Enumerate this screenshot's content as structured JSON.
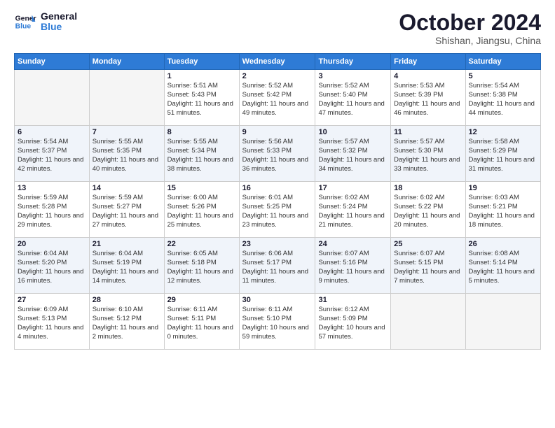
{
  "header": {
    "logo_general": "General",
    "logo_blue": "Blue",
    "month": "October 2024",
    "location": "Shishan, Jiangsu, China"
  },
  "weekdays": [
    "Sunday",
    "Monday",
    "Tuesday",
    "Wednesday",
    "Thursday",
    "Friday",
    "Saturday"
  ],
  "weeks": [
    [
      {
        "day": "",
        "info": ""
      },
      {
        "day": "",
        "info": ""
      },
      {
        "day": "1",
        "info": "Sunrise: 5:51 AM\nSunset: 5:43 PM\nDaylight: 11 hours and 51 minutes."
      },
      {
        "day": "2",
        "info": "Sunrise: 5:52 AM\nSunset: 5:42 PM\nDaylight: 11 hours and 49 minutes."
      },
      {
        "day": "3",
        "info": "Sunrise: 5:52 AM\nSunset: 5:40 PM\nDaylight: 11 hours and 47 minutes."
      },
      {
        "day": "4",
        "info": "Sunrise: 5:53 AM\nSunset: 5:39 PM\nDaylight: 11 hours and 46 minutes."
      },
      {
        "day": "5",
        "info": "Sunrise: 5:54 AM\nSunset: 5:38 PM\nDaylight: 11 hours and 44 minutes."
      }
    ],
    [
      {
        "day": "6",
        "info": "Sunrise: 5:54 AM\nSunset: 5:37 PM\nDaylight: 11 hours and 42 minutes."
      },
      {
        "day": "7",
        "info": "Sunrise: 5:55 AM\nSunset: 5:35 PM\nDaylight: 11 hours and 40 minutes."
      },
      {
        "day": "8",
        "info": "Sunrise: 5:55 AM\nSunset: 5:34 PM\nDaylight: 11 hours and 38 minutes."
      },
      {
        "day": "9",
        "info": "Sunrise: 5:56 AM\nSunset: 5:33 PM\nDaylight: 11 hours and 36 minutes."
      },
      {
        "day": "10",
        "info": "Sunrise: 5:57 AM\nSunset: 5:32 PM\nDaylight: 11 hours and 34 minutes."
      },
      {
        "day": "11",
        "info": "Sunrise: 5:57 AM\nSunset: 5:30 PM\nDaylight: 11 hours and 33 minutes."
      },
      {
        "day": "12",
        "info": "Sunrise: 5:58 AM\nSunset: 5:29 PM\nDaylight: 11 hours and 31 minutes."
      }
    ],
    [
      {
        "day": "13",
        "info": "Sunrise: 5:59 AM\nSunset: 5:28 PM\nDaylight: 11 hours and 29 minutes."
      },
      {
        "day": "14",
        "info": "Sunrise: 5:59 AM\nSunset: 5:27 PM\nDaylight: 11 hours and 27 minutes."
      },
      {
        "day": "15",
        "info": "Sunrise: 6:00 AM\nSunset: 5:26 PM\nDaylight: 11 hours and 25 minutes."
      },
      {
        "day": "16",
        "info": "Sunrise: 6:01 AM\nSunset: 5:25 PM\nDaylight: 11 hours and 23 minutes."
      },
      {
        "day": "17",
        "info": "Sunrise: 6:02 AM\nSunset: 5:24 PM\nDaylight: 11 hours and 21 minutes."
      },
      {
        "day": "18",
        "info": "Sunrise: 6:02 AM\nSunset: 5:22 PM\nDaylight: 11 hours and 20 minutes."
      },
      {
        "day": "19",
        "info": "Sunrise: 6:03 AM\nSunset: 5:21 PM\nDaylight: 11 hours and 18 minutes."
      }
    ],
    [
      {
        "day": "20",
        "info": "Sunrise: 6:04 AM\nSunset: 5:20 PM\nDaylight: 11 hours and 16 minutes."
      },
      {
        "day": "21",
        "info": "Sunrise: 6:04 AM\nSunset: 5:19 PM\nDaylight: 11 hours and 14 minutes."
      },
      {
        "day": "22",
        "info": "Sunrise: 6:05 AM\nSunset: 5:18 PM\nDaylight: 11 hours and 12 minutes."
      },
      {
        "day": "23",
        "info": "Sunrise: 6:06 AM\nSunset: 5:17 PM\nDaylight: 11 hours and 11 minutes."
      },
      {
        "day": "24",
        "info": "Sunrise: 6:07 AM\nSunset: 5:16 PM\nDaylight: 11 hours and 9 minutes."
      },
      {
        "day": "25",
        "info": "Sunrise: 6:07 AM\nSunset: 5:15 PM\nDaylight: 11 hours and 7 minutes."
      },
      {
        "day": "26",
        "info": "Sunrise: 6:08 AM\nSunset: 5:14 PM\nDaylight: 11 hours and 5 minutes."
      }
    ],
    [
      {
        "day": "27",
        "info": "Sunrise: 6:09 AM\nSunset: 5:13 PM\nDaylight: 11 hours and 4 minutes."
      },
      {
        "day": "28",
        "info": "Sunrise: 6:10 AM\nSunset: 5:12 PM\nDaylight: 11 hours and 2 minutes."
      },
      {
        "day": "29",
        "info": "Sunrise: 6:11 AM\nSunset: 5:11 PM\nDaylight: 11 hours and 0 minutes."
      },
      {
        "day": "30",
        "info": "Sunrise: 6:11 AM\nSunset: 5:10 PM\nDaylight: 10 hours and 59 minutes."
      },
      {
        "day": "31",
        "info": "Sunrise: 6:12 AM\nSunset: 5:09 PM\nDaylight: 10 hours and 57 minutes."
      },
      {
        "day": "",
        "info": ""
      },
      {
        "day": "",
        "info": ""
      }
    ]
  ]
}
